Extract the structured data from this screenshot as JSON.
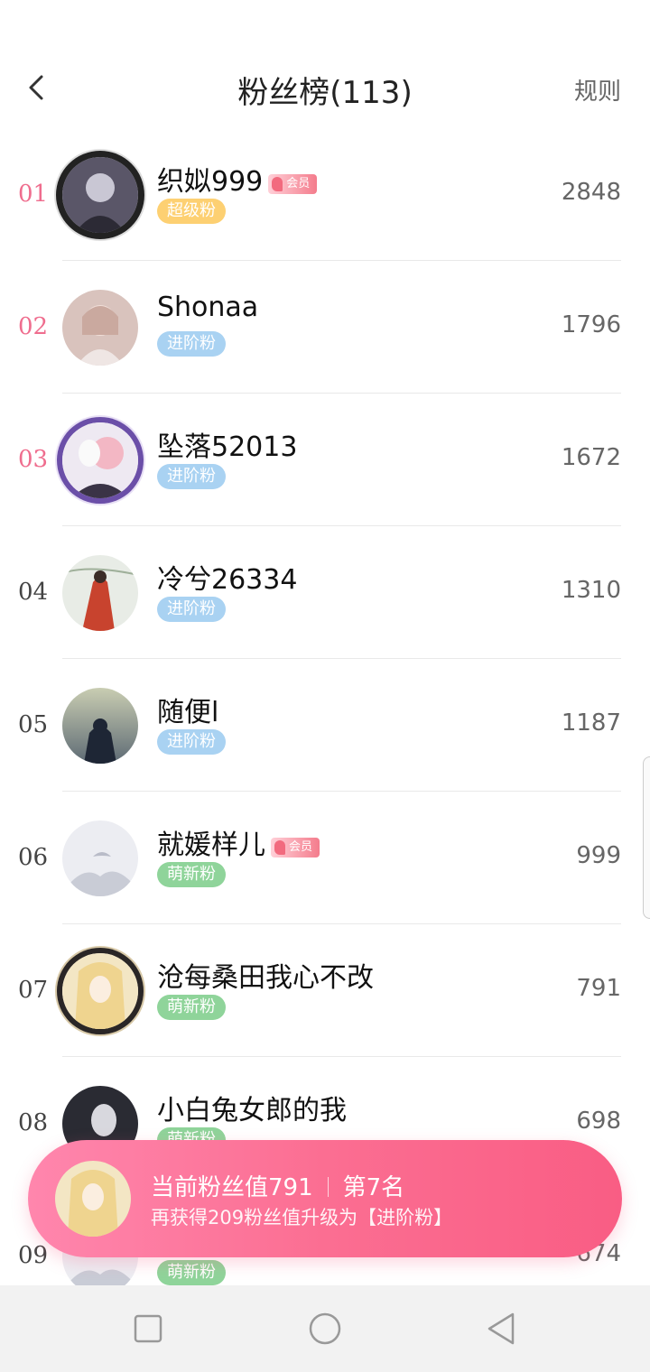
{
  "header": {
    "title": "粉丝榜(113)",
    "rules_label": "规则"
  },
  "fans": [
    {
      "rank": "01",
      "name": "织姒999",
      "vip": "会员",
      "badge": "超级粉",
      "score": "2848"
    },
    {
      "rank": "02",
      "name": "Shonaa",
      "vip": "",
      "badge": "进阶粉",
      "score": "1796"
    },
    {
      "rank": "03",
      "name": "坠落52013",
      "vip": "",
      "badge": "进阶粉",
      "score": "1672"
    },
    {
      "rank": "04",
      "name": "冷兮26334",
      "vip": "",
      "badge": "进阶粉",
      "score": "1310"
    },
    {
      "rank": "05",
      "name": "随便l",
      "vip": "",
      "badge": "进阶粉",
      "score": "1187"
    },
    {
      "rank": "06",
      "name": "就媛样儿",
      "vip": "会员",
      "badge": "萌新粉",
      "score": "999"
    },
    {
      "rank": "07",
      "name": "沧每桑田我心不改",
      "vip": "",
      "badge": "萌新粉",
      "score": "791"
    },
    {
      "rank": "08",
      "name": "小白兔女郎的我",
      "vip": "",
      "badge": "萌新粉",
      "score": "698"
    },
    {
      "rank": "09",
      "name": "",
      "vip": "",
      "badge": "萌新粉",
      "score": "674"
    }
  ],
  "summary": {
    "current_value": "当前粉丝值791",
    "position": "第7名",
    "hint": "再获得209粉丝值升级为【进阶粉】"
  },
  "colors": {
    "top_rank": "#ef6d8e",
    "badge_super": "#fdd072",
    "badge_advanced": "#a9d2f2",
    "badge_new": "#8fd49a",
    "summary_start": "#ff86ad",
    "summary_end": "#f95d84"
  }
}
